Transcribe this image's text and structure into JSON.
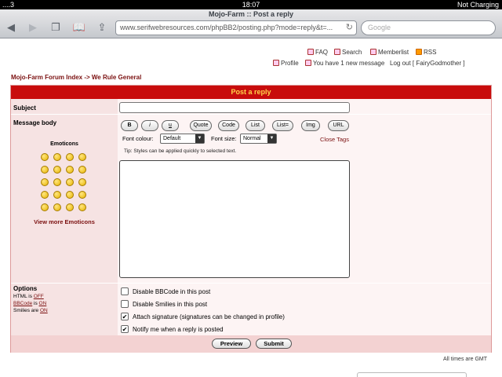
{
  "status": {
    "carrier": "....3",
    "time": "18:07",
    "battery": "Not Charging"
  },
  "browser": {
    "page_title": "Mojo-Farm :: Post a reply",
    "url": "www.serifwebresources.com/phpBB2/posting.php?mode=reply&t=...",
    "search_placeholder": "Google"
  },
  "toplinks": {
    "faq": "FAQ",
    "search": "Search",
    "memberlist": "Memberlist",
    "rss": "RSS",
    "profile": "Profile",
    "message": "You have 1 new message",
    "logout": "Log out [ FairyGodmother ]"
  },
  "breadcrumb": "Mojo-Farm Forum Index -> We Rule General",
  "form": {
    "heading": "Post a reply",
    "subject_label": "Subject",
    "body_label": "Message body",
    "toolbar": [
      "B",
      "i",
      "u",
      "Quote",
      "Code",
      "List",
      "List=",
      "Img",
      "URL"
    ],
    "font_colour_label": "Font colour:",
    "font_colour_value": "Default",
    "font_size_label": "Font size:",
    "font_size_value": "Normal",
    "close_tags": "Close Tags",
    "tip": "Tip: Styles can be applied quickly to selected text.",
    "emoticons_title": "Emoticons",
    "view_more": "View more Emoticons",
    "options_title": "Options",
    "html_status": {
      "label": "HTML is",
      "value": "OFF"
    },
    "bbcode_status": {
      "label": "is",
      "link": "BBCode",
      "value": "ON"
    },
    "smilies_status": {
      "label": "Smilies are",
      "value": "ON"
    },
    "options": [
      {
        "label": "Disable BBCode in this post",
        "checked": false
      },
      {
        "label": "Disable Smilies in this post",
        "checked": false
      },
      {
        "label": "Attach signature (signatures can be changed in profile)",
        "checked": true
      },
      {
        "label": "Notify me when a reply is posted",
        "checked": true
      }
    ],
    "preview_label": "Preview",
    "submit_label": "Submit"
  },
  "footer_times": "All times are GMT"
}
